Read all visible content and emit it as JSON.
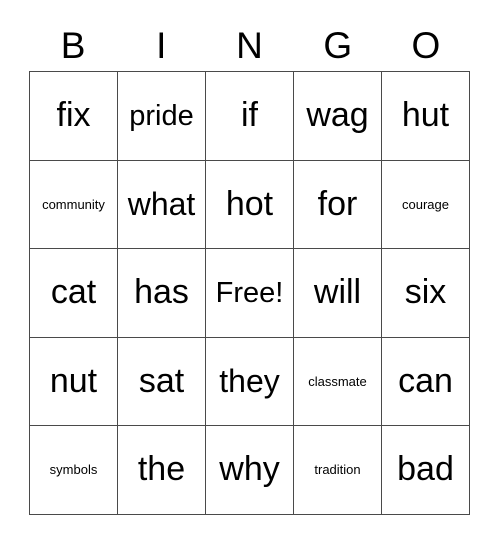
{
  "card": {
    "title": "BINGO",
    "free_space_label": "Free!",
    "colors": {
      "background": "#ffffff",
      "text": "#000000",
      "border": "#4a4a4a"
    },
    "header": {
      "letters": [
        "B",
        "I",
        "N",
        "G",
        "O"
      ]
    },
    "grid": {
      "columns": 5,
      "rows": 5,
      "cells": [
        [
          {
            "text": "fix",
            "size": "xl",
            "free": false
          },
          {
            "text": "pride",
            "size": "md",
            "free": false
          },
          {
            "text": "if",
            "size": "xl",
            "free": false
          },
          {
            "text": "wag",
            "size": "xl",
            "free": false
          },
          {
            "text": "hut",
            "size": "xl",
            "free": false
          }
        ],
        [
          {
            "text": "community",
            "size": "sm",
            "free": false
          },
          {
            "text": "what",
            "size": "lg",
            "free": false
          },
          {
            "text": "hot",
            "size": "xl",
            "free": false
          },
          {
            "text": "for",
            "size": "xl",
            "free": false
          },
          {
            "text": "courage",
            "size": "sm",
            "free": false
          }
        ],
        [
          {
            "text": "cat",
            "size": "xl",
            "free": false
          },
          {
            "text": "has",
            "size": "xl",
            "free": false
          },
          {
            "text": "Free!",
            "size": "md",
            "free": true
          },
          {
            "text": "will",
            "size": "xl",
            "free": false
          },
          {
            "text": "six",
            "size": "xl",
            "free": false
          }
        ],
        [
          {
            "text": "nut",
            "size": "xl",
            "free": false
          },
          {
            "text": "sat",
            "size": "xl",
            "free": false
          },
          {
            "text": "they",
            "size": "lg",
            "free": false
          },
          {
            "text": "classmate",
            "size": "sm",
            "free": false
          },
          {
            "text": "can",
            "size": "xl",
            "free": false
          }
        ],
        [
          {
            "text": "symbols",
            "size": "sm",
            "free": false
          },
          {
            "text": "the",
            "size": "xl",
            "free": false
          },
          {
            "text": "why",
            "size": "xl",
            "free": false
          },
          {
            "text": "tradition",
            "size": "sm",
            "free": false
          },
          {
            "text": "bad",
            "size": "xl",
            "free": false
          }
        ]
      ]
    }
  }
}
